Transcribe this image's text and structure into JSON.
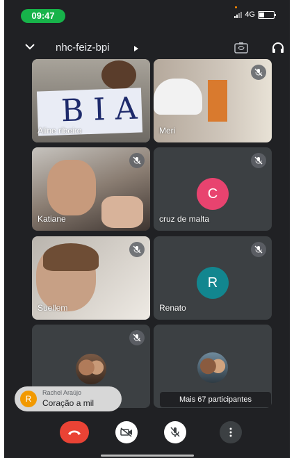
{
  "status_bar": {
    "time": "09:47",
    "network": "4G"
  },
  "header": {
    "meeting_code": "nhc-feiz-bpi"
  },
  "tiles": [
    {
      "name": "Aline ribeiro",
      "muted": false,
      "sign_text": "BIA"
    },
    {
      "name": "Meri",
      "muted": true
    },
    {
      "name": "Katiane",
      "muted": true
    },
    {
      "name": "cruz de malta",
      "muted": true,
      "initial": "C",
      "avatar_color": "#e8436f"
    },
    {
      "name": "Suellem",
      "muted": true
    },
    {
      "name": "Renato",
      "muted": true,
      "initial": "R",
      "avatar_color": "#12868f"
    },
    {
      "name": "",
      "muted": true
    },
    {
      "name": "",
      "muted": false
    }
  ],
  "overflow": {
    "label": "Mais 67 participantes"
  },
  "chat_toast": {
    "avatar_initial": "R",
    "sender": "Rachel Araújo",
    "message": "Coração a mil"
  },
  "controls": {
    "end_call_icon": "phone-hangup-icon",
    "camera_icon": "camera-off-icon",
    "mic_icon": "mic-off-icon",
    "more_icon": "more-vert-icon"
  },
  "colors": {
    "background": "#202124",
    "tile": "#3c4043",
    "end_call": "#ea4335",
    "time_pill": "#17b34a"
  }
}
